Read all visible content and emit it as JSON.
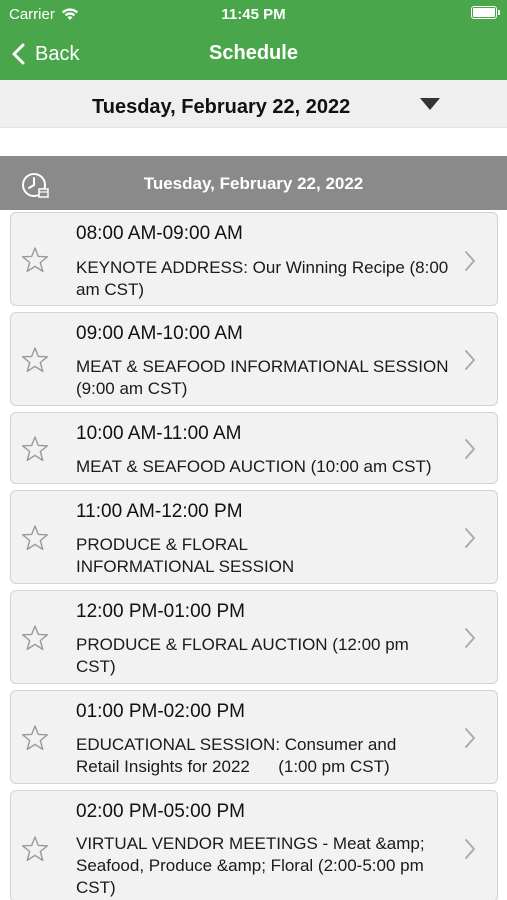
{
  "status_bar": {
    "carrier": "Carrier",
    "time": "11:45 PM"
  },
  "nav": {
    "back_label": "Back",
    "title": "Schedule"
  },
  "date_picker": {
    "selected": "Tuesday, February 22, 2022"
  },
  "section": {
    "title": "Tuesday, February 22, 2022"
  },
  "sessions": [
    {
      "time": "08:00 AM-09:00 AM",
      "title": "KEYNOTE ADDRESS:  Our Winning Recipe (8:00 am CST)"
    },
    {
      "time": "09:00 AM-10:00 AM",
      "title": "MEAT & SEAFOOD INFORMATIONAL SESSION (9:00 am CST)"
    },
    {
      "time": "10:00 AM-11:00 AM",
      "title": "MEAT & SEAFOOD AUCTION (10:00 am CST)"
    },
    {
      "time": "11:00 AM-12:00 PM",
      "title": "PRODUCE & FLORAL INFORMATIONAL SESSION"
    },
    {
      "time": "12:00 PM-01:00 PM",
      "title": "PRODUCE & FLORAL AUCTION (12:00 pm CST)"
    },
    {
      "time": "01:00 PM-02:00 PM",
      "title": "EDUCATIONAL SESSION: Consumer and Retail Insights for 2022      (1:00 pm CST)"
    },
    {
      "time": "02:00 PM-05:00 PM",
      "title": "VIRTUAL VENDOR MEETINGS - Meat &amp; Seafood, Produce &amp; Floral (2:00-5:00 pm CST)"
    }
  ],
  "icons": {
    "favorite": "star-outline-icon",
    "disclosure": "chevron-right-icon",
    "section": "clock-calendar-icon",
    "back": "chevron-left-icon",
    "dropdown": "triangle-down-icon"
  },
  "colors": {
    "nav_green": "#4aa64a",
    "section_gray": "#8a8a8a",
    "card_bg": "#f2f2f2"
  }
}
